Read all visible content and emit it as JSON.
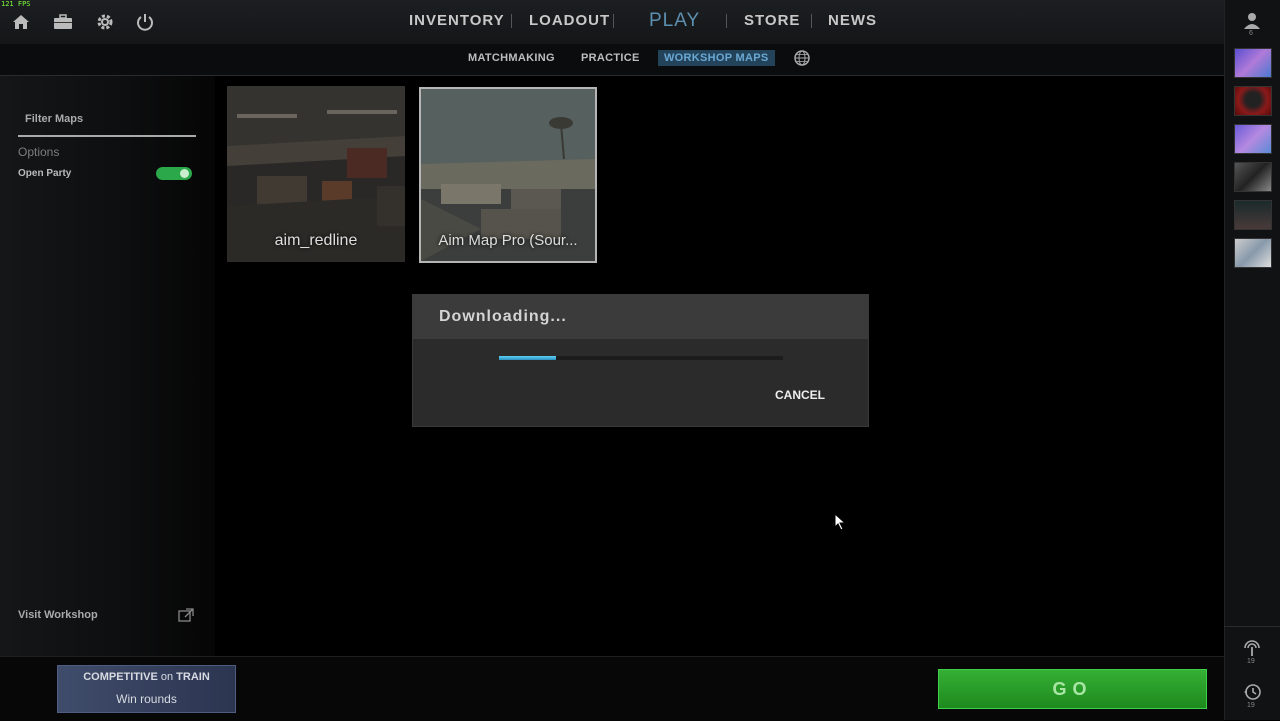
{
  "fps": "121 FPS",
  "top_icons": [
    "home-icon",
    "briefcase-icon",
    "gear-icon",
    "power-icon"
  ],
  "nav": {
    "inventory": "INVENTORY",
    "loadout": "LOADOUT",
    "play": "PLAY",
    "store": "STORE",
    "news": "NEWS"
  },
  "subnav": {
    "matchmaking": "MATCHMAKING",
    "practice": "PRACTICE",
    "workshop_maps": "WORKSHOP MAPS",
    "globe_icon": "globe-icon"
  },
  "left_panel": {
    "filter_maps": "Filter Maps",
    "options": "Options",
    "open_party": "Open Party",
    "open_party_on": true,
    "visit_workshop": "Visit Workshop"
  },
  "maps": [
    {
      "name": "aim_redline",
      "selected": false
    },
    {
      "name": "Aim Map Pro (Sour...",
      "selected": true
    }
  ],
  "dialog": {
    "title": "Downloading...",
    "progress": 0.2,
    "cancel": "CANCEL"
  },
  "bottom": {
    "mode": "COMPETITIVE",
    "on": "on",
    "map": "TRAIN",
    "objective": "Win rounds",
    "go": "GO"
  },
  "rail": {
    "friends_count": "6",
    "signal_count": "19",
    "history_count": "19"
  },
  "colors": {
    "accent_blue": "#5d8fb1",
    "toggle_green": "#2aa84a",
    "go_green": "#28a828",
    "progress_blue": "#3ab0e0"
  }
}
